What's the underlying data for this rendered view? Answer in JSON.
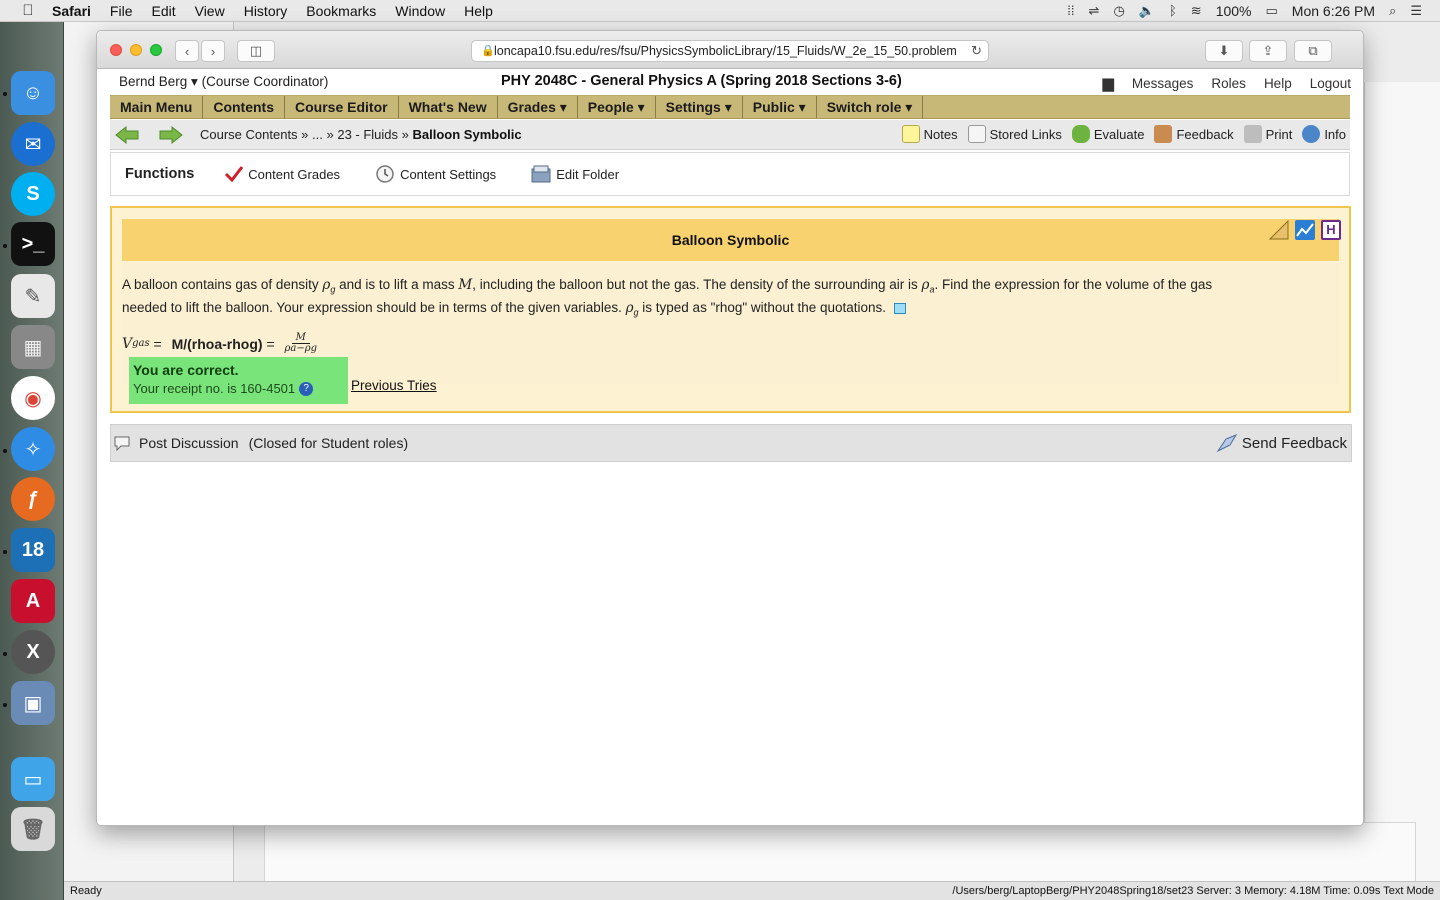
{
  "menubar": {
    "app": "Safari",
    "items": [
      "File",
      "Edit",
      "View",
      "History",
      "Bookmarks",
      "Window",
      "Help"
    ],
    "battery": "100%",
    "clock": "Mon 6:26 PM"
  },
  "browser": {
    "url": "loncapa10.fsu.edu/res/fsu/PhysicsSymbolicLibrary/15_Fluids/W_2e_15_50.problem"
  },
  "userbar": {
    "user": "Bernd Berg ▾",
    "role": "(Course Coordinator)",
    "course": "PHY 2048C - General Physics A (Spring 2018 Sections 3-6)",
    "links": [
      "Messages",
      "Roles",
      "Help",
      "Logout"
    ]
  },
  "mainnav": [
    "Main Menu",
    "Contents",
    "Course Editor",
    "What's New",
    "Grades ▾",
    "People ▾",
    "Settings ▾",
    "Public ▾",
    "Switch role ▾"
  ],
  "breadcrumbs": {
    "part1": "Course Contents",
    "sep1": " » ",
    "part2": "...",
    "sep2": " » ",
    "part3": "23 - Fluids",
    "sep3": " » ",
    "current": "Balloon Symbolic"
  },
  "tools": [
    "Notes",
    "Stored Links",
    "Evaluate",
    "Feedback",
    "Print",
    "Info"
  ],
  "functions": {
    "title": "Functions",
    "items": [
      "Content Grades",
      "Content Settings",
      "Edit Folder"
    ]
  },
  "problem": {
    "title": "Balloon Symbolic",
    "line1a": "A balloon contains gas of density ",
    "rho_g": "ρ",
    "g_sub": "g",
    "line1b": " and is to lift a mass ",
    "M": "M",
    "line1c": ", including the balloon but not the gas. The density of the surrounding air is ",
    "rho_a": "ρ",
    "a_sub": "a",
    "line1d": ". Find the expression for the volume of the gas",
    "line2a": "needed to lift the balloon. Your expression should be in terms of the given variables. ",
    "line2b": " is typed as \"rhog\" without the quotations.",
    "answer_var": "V",
    "answer_sub": "gas",
    "answer_eq": " = ",
    "answer_expr": "M/(rhoa-rhog)",
    "answer_eq2": " = ",
    "frac_num": "M",
    "frac_den": "ρa−ρg",
    "correct_msg": "You are correct.",
    "receipt": "Your receipt no. is 160-4501",
    "previous_tries": "Previous Tries"
  },
  "discussion": {
    "post": "Post Discussion",
    "closed": "(Closed for Student roles)",
    "send": "Send Feedback"
  },
  "statusbar": {
    "left": "Ready",
    "right": "/Users/berg/LaptopBerg/PHY2048Spring18/set23   Server: 3   Memory: 4.18M   Time: 0.09s   Text Mode"
  },
  "colors": {
    "nav_bg": "#c8b878",
    "problem_header": "#f9d270",
    "correct_bg": "#79e479"
  }
}
